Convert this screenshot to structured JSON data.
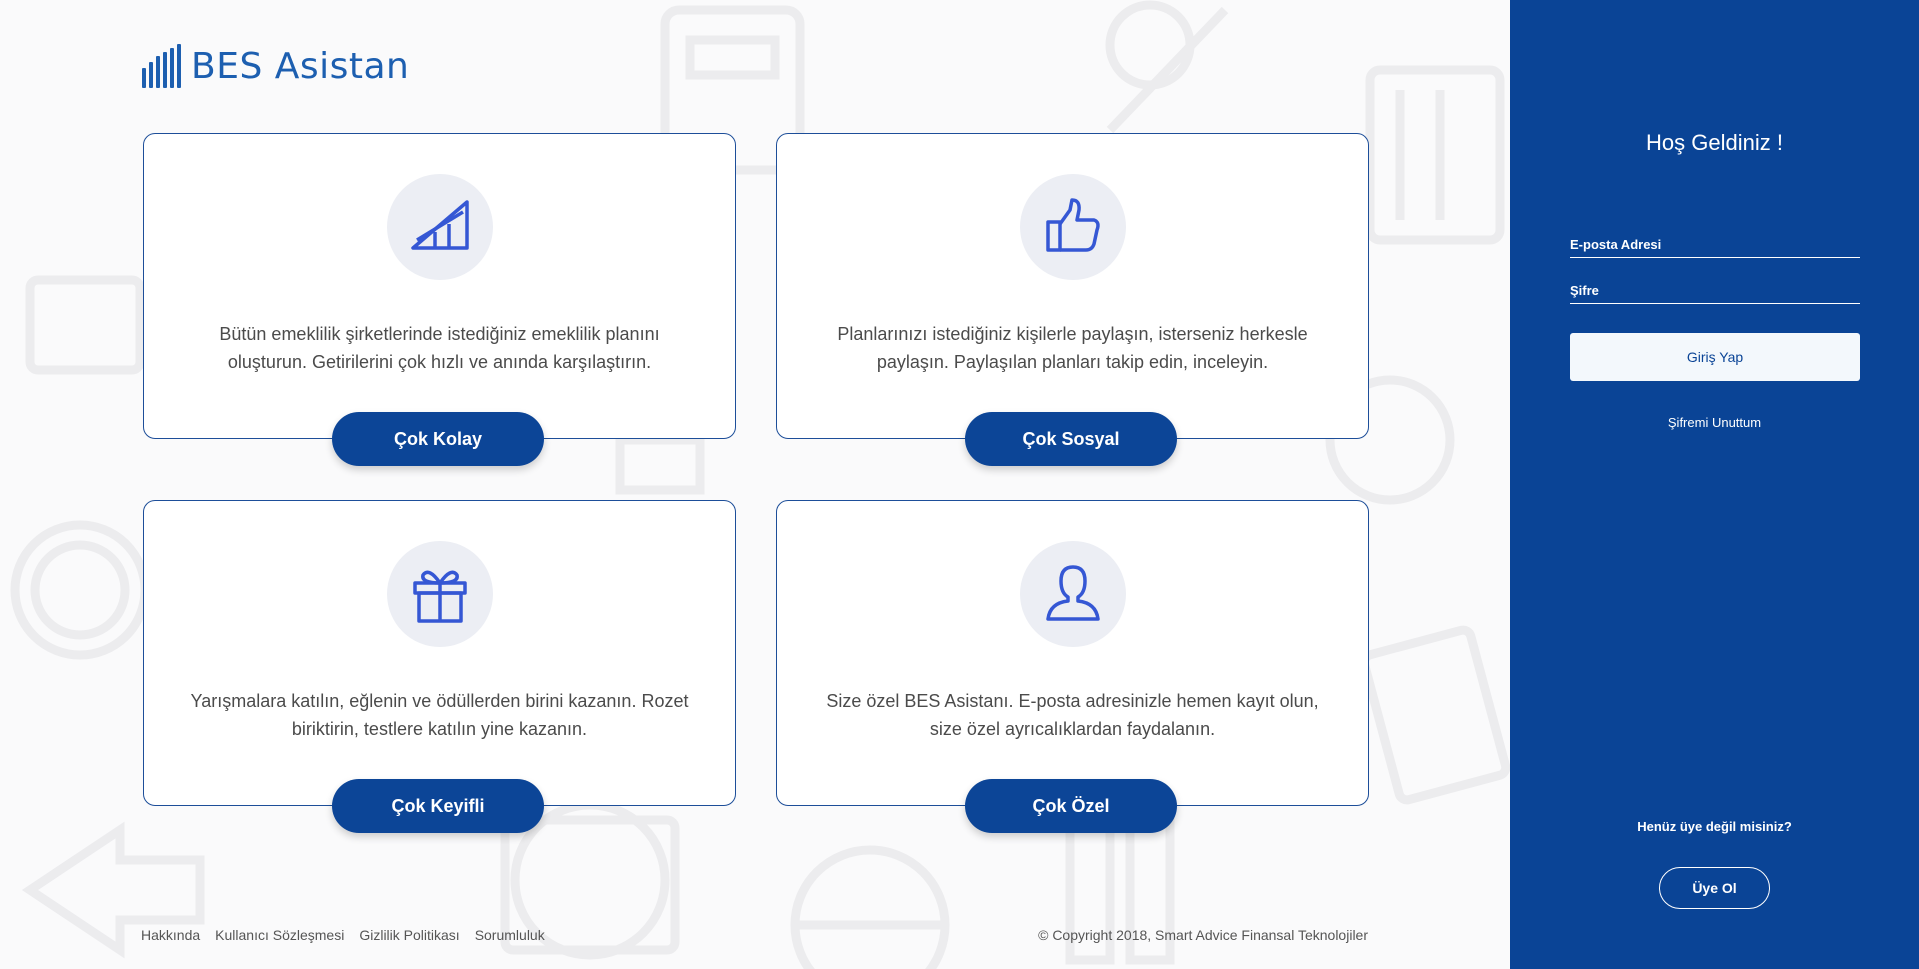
{
  "brand": {
    "name": "BES Asistan",
    "color": "#1d5fb0",
    "logo_icon": "bar-chart-icon"
  },
  "cards": [
    {
      "icon": "growth-chart-icon",
      "description": "Bütün emeklilik şirketlerinde istediğiniz emeklilik planını oluşturun. Getirilerini çok hızlı ve anında karşılaştırın.",
      "button": "Çok Kolay"
    },
    {
      "icon": "thumbs-up-icon",
      "description": "Planlarınızı istediğiniz kişilerle paylaşın, isterseniz herkesle paylaşın. Paylaşılan planları takip edin, inceleyin.",
      "button": "Çok Sosyal"
    },
    {
      "icon": "gift-icon",
      "description": "Yarışmalara katılın, eğlenin ve ödüllerden birini kazanın. Rozet biriktirin, testlere katılın yine kazanın.",
      "button": "Çok Keyifli"
    },
    {
      "icon": "user-icon",
      "description": "Size özel BES Asistanı. E-posta adresinizle hemen kayıt olun, size özel ayrıcalıklardan faydalanın.",
      "button": "Çok Özel"
    }
  ],
  "footer": {
    "links": [
      "Hakkında",
      "Kullanıcı Sözleşmesi",
      "Gizlilik Politikası",
      "Sorumluluk"
    ],
    "copyright": "© Copyright 2018, Smart Advice Finansal Teknolojiler"
  },
  "sidebar": {
    "welcome": "Hoş Geldiniz !",
    "email_placeholder": "E-posta Adresi",
    "password_placeholder": "Şifre",
    "login_button": "Giriş Yap",
    "forgot_password": "Şifremi Unuttum",
    "not_member": "Henüz üye değil misiniz?",
    "signup_button": "Üye Ol"
  },
  "colors": {
    "primary": "#0a4496",
    "card_border": "#1d4e99",
    "icon_blue": "#3557d4",
    "icon_bg": "#eceef4"
  }
}
